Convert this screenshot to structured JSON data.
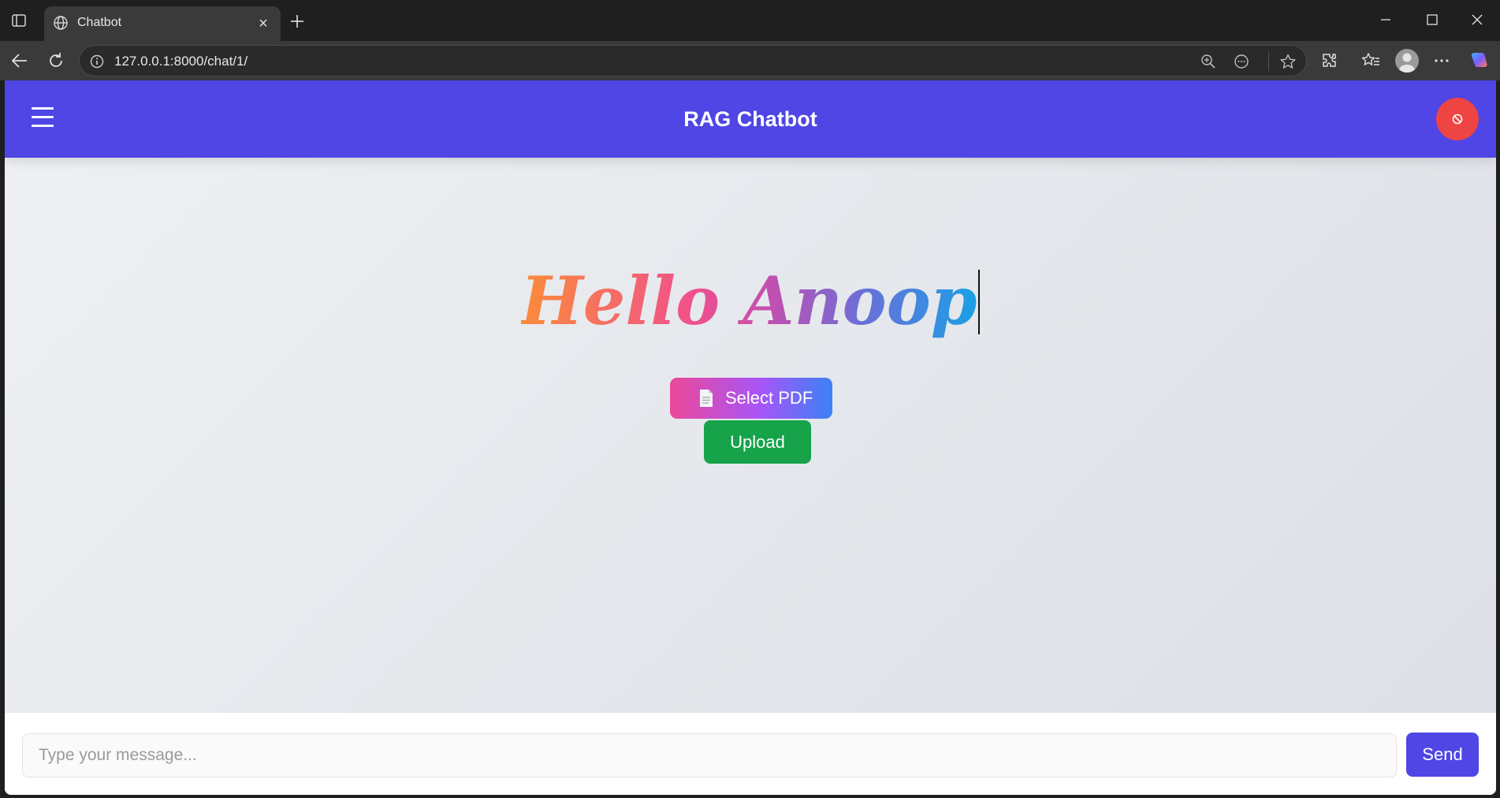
{
  "browser": {
    "tab_title": "Chatbot",
    "url": "127.0.0.1:8000/chat/1/"
  },
  "app": {
    "title": "RAG Chatbot",
    "greeting": "Hello Anoop",
    "select_pdf_label": "Select PDF",
    "upload_label": "Upload",
    "message_placeholder": "Type your message...",
    "send_label": "Send"
  },
  "colors": {
    "header": "#4f46e5",
    "logout": "#ef4444",
    "upload": "#16a34a",
    "send": "#4f46e5"
  },
  "icons": [
    "sidebar-toggle-icon",
    "globe-icon",
    "close-icon",
    "plus-icon",
    "minimize-icon",
    "maximize-icon",
    "back-icon",
    "refresh-icon",
    "info-icon",
    "zoom-icon",
    "reader-icon",
    "star-icon",
    "extensions-icon",
    "favorites-icon",
    "profile-icon",
    "more-icon",
    "copilot-icon",
    "menu-icon",
    "logout-icon",
    "document-icon"
  ]
}
